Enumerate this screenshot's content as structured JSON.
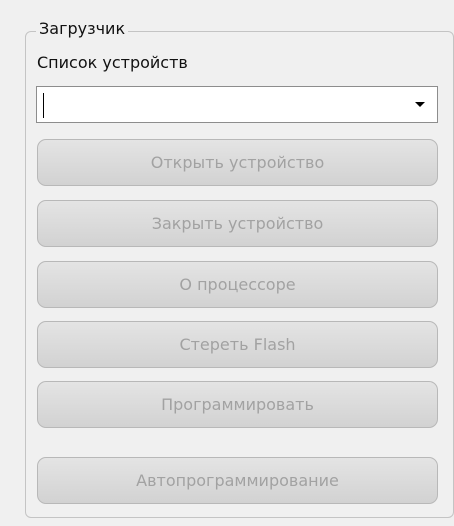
{
  "loader": {
    "group_title": "Загрузчик",
    "device_list_label": "Список устройств",
    "device_selector": {
      "value": ""
    },
    "buttons": {
      "open_device": "Открыть устройство",
      "close_device": "Закрыть устройство",
      "about_processor": "О процессоре",
      "erase_flash": "Стереть Flash",
      "program": "Программировать",
      "auto_program": "Автопрограммирование"
    }
  },
  "colors": {
    "window_background": "#f0f0f0",
    "disabled_text": "#a2a2a2",
    "button_border": "#b8b8b8"
  },
  "icons": {
    "dropdown": "chevron-down-icon"
  }
}
